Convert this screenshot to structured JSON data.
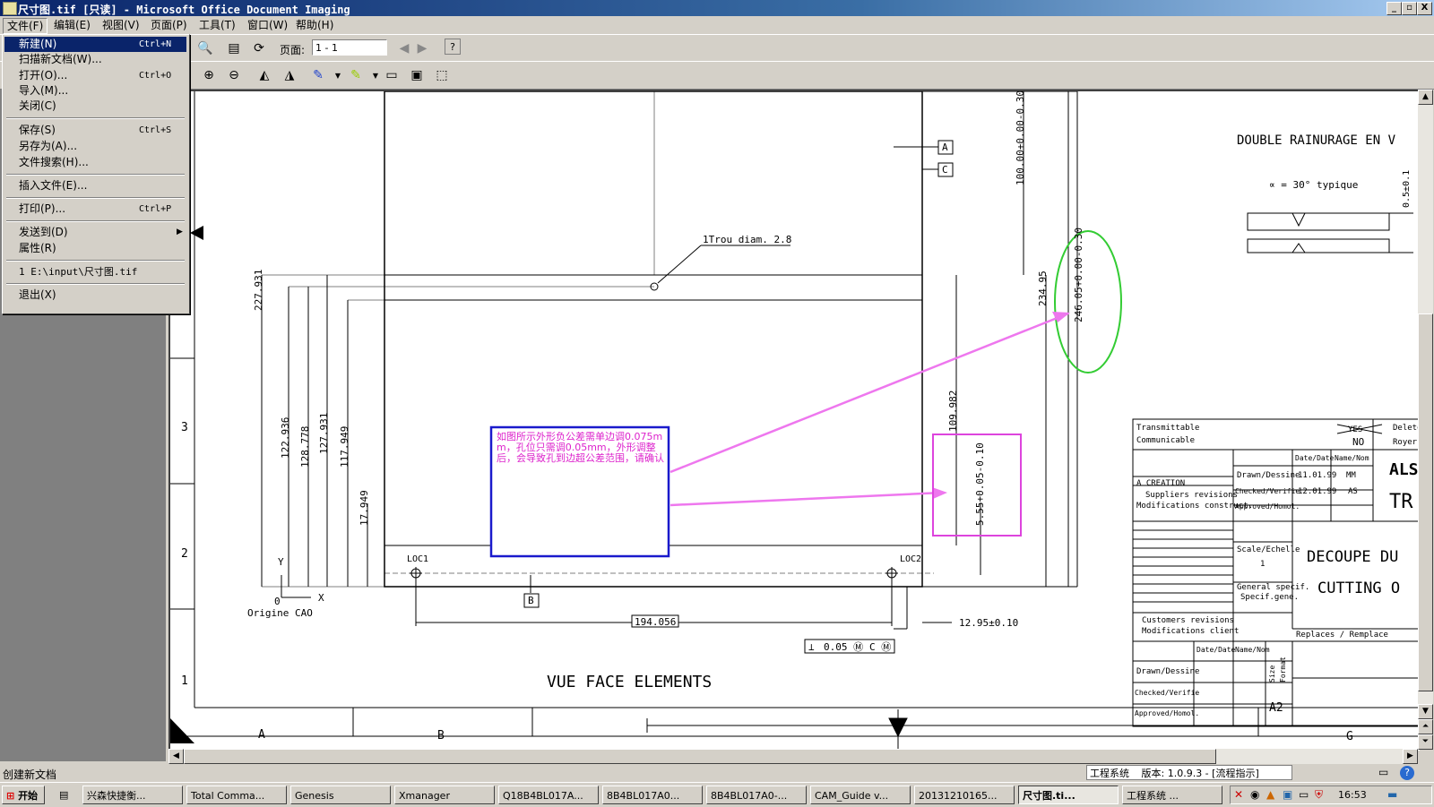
{
  "window": {
    "title": "尺寸图.tif [只读] - Microsoft Office Document Imaging",
    "min": "_",
    "max": "▫",
    "close": "X"
  },
  "menubar": [
    "文件(F)",
    "编辑(E)",
    "视图(V)",
    "页面(P)",
    "工具(T)",
    "窗口(W)",
    "帮助(H)"
  ],
  "file_menu": [
    {
      "label": "新建(N)",
      "shortcut": "Ctrl+N"
    },
    {
      "label": "扫描新文档(W)...",
      "shortcut": ""
    },
    {
      "label": "打开(O)...",
      "shortcut": "Ctrl+O"
    },
    {
      "label": "导入(M)...",
      "shortcut": ""
    },
    {
      "label": "关闭(C)",
      "shortcut": ""
    },
    {
      "label": "保存(S)",
      "shortcut": "Ctrl+S"
    },
    {
      "label": "另存为(A)...",
      "shortcut": ""
    },
    {
      "label": "文件搜索(H)...",
      "shortcut": ""
    },
    {
      "label": "插入文件(E)...",
      "shortcut": ""
    },
    {
      "label": "打印(P)...",
      "shortcut": "Ctrl+P"
    },
    {
      "label": "发送到(D)",
      "shortcut": ""
    },
    {
      "label": "属性(R)",
      "shortcut": ""
    },
    {
      "label": "1 E:\\input\\尺寸图.tif",
      "shortcut": ""
    },
    {
      "label": "退出(X)",
      "shortcut": ""
    }
  ],
  "toolbar": {
    "page_label": "页面:",
    "page_value": "1 - 1"
  },
  "statusbar": {
    "left": "创建新文档"
  },
  "drawing": {
    "dims_left": [
      "227.931",
      "122.936",
      "128.778",
      "127.931",
      "117.949",
      "17.949"
    ],
    "dims_right": [
      "100.00+0.00-0.30",
      "234.95",
      "246.05+0.00-0.30",
      "109.982",
      "5.55+0.05-0.10"
    ],
    "trou": "1Trou diam. 2.8",
    "labels_ac": [
      "A",
      "C",
      "B"
    ],
    "loc1": "LOC1",
    "loc2": "LOC2",
    "y": "Y",
    "x": "X",
    "zero": "0",
    "origine": "Origine CAO",
    "dim_194": "194.056",
    "dim_1295": "12.95±0.10",
    "tol_frame": [
      "⊥",
      "0.05 Ⓜ",
      "C Ⓜ"
    ],
    "vue": "VUE FACE ELEMENTS",
    "double": "DOUBLE RAINURAGE EN V",
    "alpha": "∝ = 30° typique",
    "dim_05": "0.5±0.1",
    "row_numbers": [
      "3",
      "2",
      "1"
    ],
    "col_letters": [
      "A",
      "B",
      "G"
    ],
    "annotation": "如图所示外形负公差需单边调0.075mm，孔位只需调0.05mm，外形调整后，会导致孔到边超公差范围，请确认",
    "title_block": {
      "transmittable": "Transmittable",
      "communicable": "Communicable",
      "yes": "YES",
      "no": "NO",
      "delete": "Delete",
      "royer": "Royer",
      "date_head": "Date/Date",
      "name_head": "Name/Nom",
      "drawn": "Drawn/Dessine",
      "checked": "Checked/Verifie",
      "approved": "Approved/Homol.",
      "date1": "11.01.99",
      "name1": "MM",
      "date2": "12.01.99",
      "name2": "AS",
      "creation": "A  CREATION",
      "suppliers": "Suppliers revisions",
      "modif": "Modifications construct.",
      "scale": "Scale/Echelle",
      "scale_val": "1",
      "general": "General specif.",
      "specif": "Specif.gene.",
      "customers": "Customers revisions",
      "modif_client": "Modifications client",
      "replaces": "Replaces / Remplace",
      "decoupe": "DECOUPE DU",
      "cutting": "CUTTING O",
      "als": "ALS",
      "tr": "TR",
      "size": "Size",
      "format": "Format",
      "a2": "A2"
    }
  },
  "taskbar": {
    "start": "开始",
    "items": [
      "兴森快捷衡...",
      "Total Comma...",
      "Genesis",
      "Xmanager",
      "Q18B4BL017A...",
      "8B4BL017A0...",
      "8B4BL017A0-...",
      "CAM_Guide v...",
      "20131210165...",
      "尺寸图.ti...",
      "工程系统   ..."
    ],
    "clock": "16:53"
  },
  "engineering": {
    "label": "工程系统",
    "version": "版本: 1.0.9.3 - [流程指示]"
  },
  "colors": {
    "title_blue": "#0a246a",
    "annot_border": "#1a1acc",
    "annot_text": "#dd22cc",
    "green_ellipse": "#33cc33",
    "pink_arrow": "#ee77ee",
    "magenta_box": "#dd44dd"
  }
}
